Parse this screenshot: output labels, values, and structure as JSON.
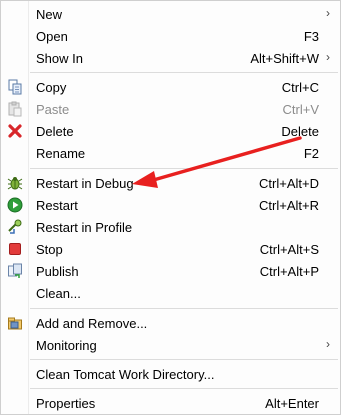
{
  "menu": {
    "items": [
      {
        "key": "new",
        "label": "New",
        "shortcut": "",
        "submenu": true,
        "icon": "none",
        "disabled": false
      },
      {
        "key": "open",
        "label": "Open",
        "shortcut": "F3",
        "submenu": false,
        "icon": "none",
        "disabled": false
      },
      {
        "key": "show_in",
        "label": "Show In",
        "shortcut": "Alt+Shift+W",
        "submenu": true,
        "icon": "none",
        "disabled": false
      },
      {
        "key": "copy",
        "label": "Copy",
        "shortcut": "Ctrl+C",
        "submenu": false,
        "icon": "copy-icon",
        "disabled": false
      },
      {
        "key": "paste",
        "label": "Paste",
        "shortcut": "Ctrl+V",
        "submenu": false,
        "icon": "paste-icon",
        "disabled": true
      },
      {
        "key": "delete",
        "label": "Delete",
        "shortcut": "Delete",
        "submenu": false,
        "icon": "delete-icon",
        "disabled": false
      },
      {
        "key": "rename",
        "label": "Rename",
        "shortcut": "F2",
        "submenu": false,
        "icon": "none",
        "disabled": false
      },
      {
        "key": "restart_debug",
        "label": "Restart in Debug",
        "shortcut": "Ctrl+Alt+D",
        "submenu": false,
        "icon": "debug-bug-icon",
        "disabled": false
      },
      {
        "key": "restart",
        "label": "Restart",
        "shortcut": "Ctrl+Alt+R",
        "submenu": false,
        "icon": "restart-icon",
        "disabled": false
      },
      {
        "key": "restart_profile",
        "label": "Restart in Profile",
        "shortcut": "",
        "submenu": false,
        "icon": "profile-icon",
        "disabled": false
      },
      {
        "key": "stop",
        "label": "Stop",
        "shortcut": "Ctrl+Alt+S",
        "submenu": false,
        "icon": "stop-icon",
        "disabled": false
      },
      {
        "key": "publish",
        "label": "Publish",
        "shortcut": "Ctrl+Alt+P",
        "submenu": false,
        "icon": "publish-icon",
        "disabled": false
      },
      {
        "key": "clean",
        "label": "Clean...",
        "shortcut": "",
        "submenu": false,
        "icon": "none",
        "disabled": false
      },
      {
        "key": "add_remove",
        "label": "Add and Remove...",
        "shortcut": "",
        "submenu": false,
        "icon": "add-remove-icon",
        "disabled": false
      },
      {
        "key": "monitoring",
        "label": "Monitoring",
        "shortcut": "",
        "submenu": true,
        "icon": "none",
        "disabled": false
      },
      {
        "key": "clean_tomcat",
        "label": "Clean Tomcat Work Directory...",
        "shortcut": "",
        "submenu": false,
        "icon": "none",
        "disabled": false
      },
      {
        "key": "properties",
        "label": "Properties",
        "shortcut": "Alt+Enter",
        "submenu": false,
        "icon": "none",
        "disabled": false
      }
    ],
    "submenu_glyph": "›"
  },
  "colors": {
    "annotation_arrow": "#e8201f",
    "disabled_text": "#8c8c8c"
  }
}
